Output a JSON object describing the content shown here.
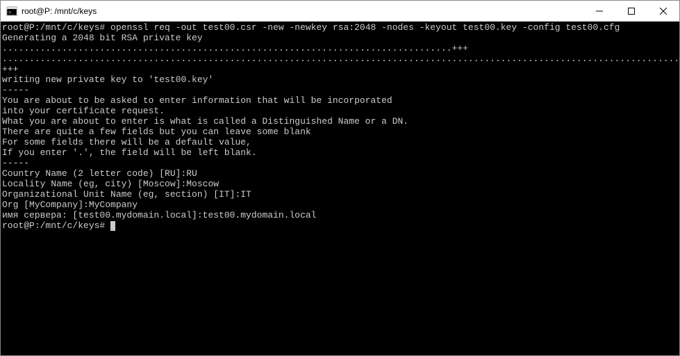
{
  "titlebar": {
    "icon_name": "terminal-icon",
    "title": "root@P: /mnt/c/keys",
    "minimize_symbol": "─",
    "maximize_symbol": "☐",
    "close_symbol": "✕"
  },
  "terminal": {
    "prompt1": "root@P:/mnt/c/keys#",
    "command1": " openssl req -out test00.csr -new -newkey rsa:2048 -nodes -keyout test00.key -config test00.cfg",
    "gen_line": "Generating a 2048 bit RSA private key",
    "dots1": "...................................................................................+++",
    "dots2": "..........................................................................................................................................+++",
    "writing": "writing new private key to 'test00.key'",
    "dash1": "-----",
    "info1": "You are about to be asked to enter information that will be incorporated",
    "info2": "into your certificate request.",
    "info3": "What you are about to enter is what is called a Distinguished Name or a DN.",
    "info4": "There are quite a few fields but you can leave some blank",
    "info5": "For some fields there will be a default value,",
    "info6": "If you enter '.', the field will be left blank.",
    "dash2": "-----",
    "country": "Country Name (2 letter code) [RU]:RU",
    "locality": "Locality Name (eg, city) [Moscow]:Moscow",
    "org_unit": "Organizational Unit Name (eg, section) [IT]:IT",
    "org": "Org [MyCompany]:MyCompany",
    "server_name": "имя сервера: [test00.mydomain.local]:test00.mydomain.local",
    "prompt2": "root@P:/mnt/c/keys#"
  }
}
